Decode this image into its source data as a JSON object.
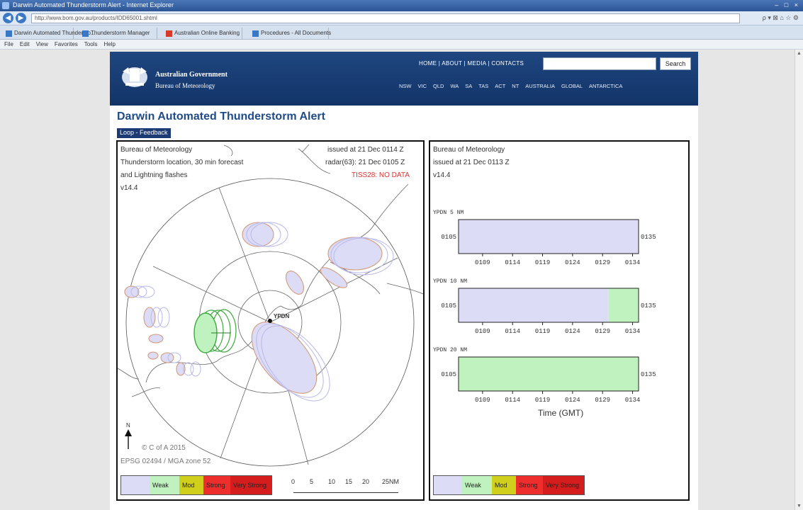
{
  "browser": {
    "title": "Darwin Automated Thunderstorm Alert - Internet Explorer",
    "url": "http://www.bom.gov.au/products/IDD65001.shtml",
    "tabs": [
      {
        "label": "Darwin Automated Thundersto...",
        "color": "#3a78c6"
      },
      {
        "label": "Thunderstorm Manager",
        "color": "#3a78c6"
      },
      {
        "label": "Australian Online Banking",
        "color": "#d83a2a"
      },
      {
        "label": "Procedures - All Documents",
        "color": "#3a78c6"
      }
    ],
    "menu": [
      "File",
      "Edit",
      "View",
      "Favorites",
      "Tools",
      "Help"
    ],
    "window_buttons": "– □ ×",
    "addr_tools": "ρ ▾ ⊠ ⌂ ☆ ⚙"
  },
  "header": {
    "gov_name": "Australian Government",
    "bureau_name": "Bureau of Meteorology",
    "links": [
      "HOME",
      "ABOUT",
      "MEDIA",
      "CONTACTS"
    ],
    "search_placeholder": "",
    "search_label": "Search",
    "regions": [
      "NSW",
      "VIC",
      "QLD",
      "WA",
      "SA",
      "TAS",
      "ACT",
      "NT",
      "AUSTRALIA",
      "GLOBAL",
      "ANTARCTICA"
    ]
  },
  "page": {
    "title": "Darwin Automated Thunderstorm Alert",
    "loop_link": "Loop",
    "separator": " - ",
    "feedback_link": "Feedback"
  },
  "map": {
    "org": "Bureau of Meteorology",
    "desc1": "Thunderstorm location, 30 min forecast",
    "desc2": "and Lightning flashes",
    "version": "v14.4",
    "issued": "issued at 21 Dec 0114 Z",
    "radar": "radar(63): 21 Dec 0105 Z",
    "status": "TISS28: NO DATA",
    "location": "YPDN",
    "north": "N",
    "copyright": "© C of A 2015",
    "projection": "EPSG 02494 / MGA zone 52",
    "legend": [
      {
        "label": "",
        "color": "#dcdcf6"
      },
      {
        "label": "Weak",
        "color": "#bff2bf"
      },
      {
        "label": "Mod",
        "color": "#cfcf1c"
      },
      {
        "label": "Strong",
        "color": "#ee2d2d"
      },
      {
        "label": "Very Strong",
        "color": "#d51d1d"
      }
    ],
    "scale_labels": [
      "0",
      "5",
      "10",
      "15",
      "20",
      "25NM"
    ]
  },
  "chart": {
    "org": "Bureau of Meteorology",
    "issued": "issued at 21 Dec 0113 Z",
    "version": "v14.4",
    "xlabel": "Time (GMT)",
    "legend": [
      {
        "label": "",
        "color": "#dcdcf6"
      },
      {
        "label": "Weak",
        "color": "#bff2bf"
      },
      {
        "label": "Mod",
        "color": "#cfcf1c"
      },
      {
        "label": "Strong",
        "color": "#ee2d2d"
      },
      {
        "label": "Very Strong",
        "color": "#d51d1d"
      }
    ]
  },
  "chart_data": [
    {
      "type": "bar",
      "title": "YPDN 5 NM",
      "range_labels": [
        "0105",
        "0135"
      ],
      "tick_labels": [
        "0109",
        "0114",
        "0119",
        "0124",
        "0129",
        "0134"
      ],
      "segments": [
        {
          "start": "0105",
          "end": "0135",
          "category": "none",
          "color": "#dcdcf6"
        }
      ]
    },
    {
      "type": "bar",
      "title": "YPDN 10 NM",
      "range_labels": [
        "0105",
        "0135"
      ],
      "tick_labels": [
        "0109",
        "0114",
        "0119",
        "0124",
        "0129",
        "0134"
      ],
      "segments": [
        {
          "start": "0105",
          "end": "0130",
          "category": "none",
          "color": "#dcdcf6"
        },
        {
          "start": "0130",
          "end": "0135",
          "category": "Weak",
          "color": "#bff2bf"
        }
      ]
    },
    {
      "type": "bar",
      "title": "YPDN 20 NM",
      "range_labels": [
        "0105",
        "0135"
      ],
      "tick_labels": [
        "0109",
        "0114",
        "0119",
        "0124",
        "0129",
        "0134"
      ],
      "segments": [
        {
          "start": "0105",
          "end": "0135",
          "category": "Weak",
          "color": "#bff2bf"
        }
      ]
    }
  ]
}
